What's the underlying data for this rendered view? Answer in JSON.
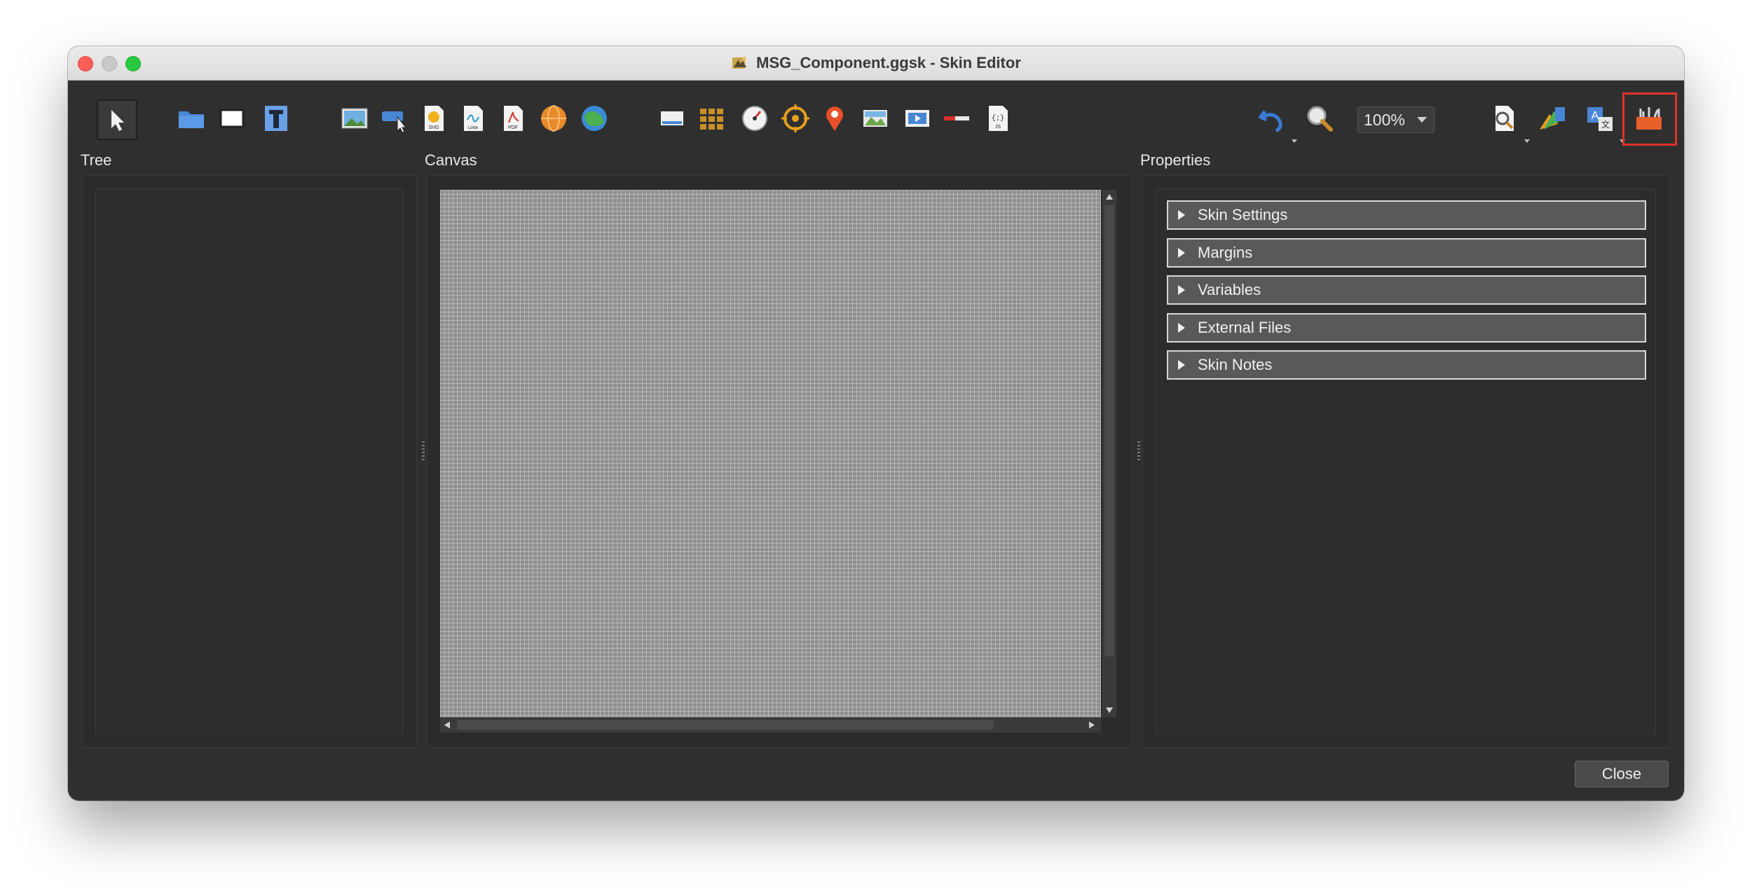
{
  "window": {
    "title": "MSG_Component.ggsk - Skin Editor",
    "close_label": "Close"
  },
  "toolbar": {
    "zoom": "100%",
    "icons": [
      "select-pointer-icon",
      "folder-icon",
      "rectangle-icon",
      "text-icon",
      "image-icon",
      "button-cursor-icon",
      "svg-file-icon",
      "lottie-file-icon",
      "pdf-file-icon",
      "globe-orange-icon",
      "globe-green-icon",
      "thumbnail-bar-icon",
      "grid-icon",
      "compass-dial-icon",
      "target-icon",
      "map-pin-icon",
      "map-image-icon",
      "video-icon",
      "slider-icon",
      "js-file-icon",
      "undo-icon",
      "zoom-icon",
      "preview-icon",
      "color-icon",
      "translate-icon",
      "tools-icon"
    ]
  },
  "panels": {
    "tree": "Tree",
    "canvas": "Canvas",
    "properties": "Properties"
  },
  "properties": {
    "sections": [
      "Skin Settings",
      "Margins",
      "Variables",
      "External Files",
      "Skin Notes"
    ]
  },
  "colors": {
    "window_bg": "#2f2f2f",
    "highlight": "#e0332a",
    "accent_blue": "#4a86d6"
  }
}
